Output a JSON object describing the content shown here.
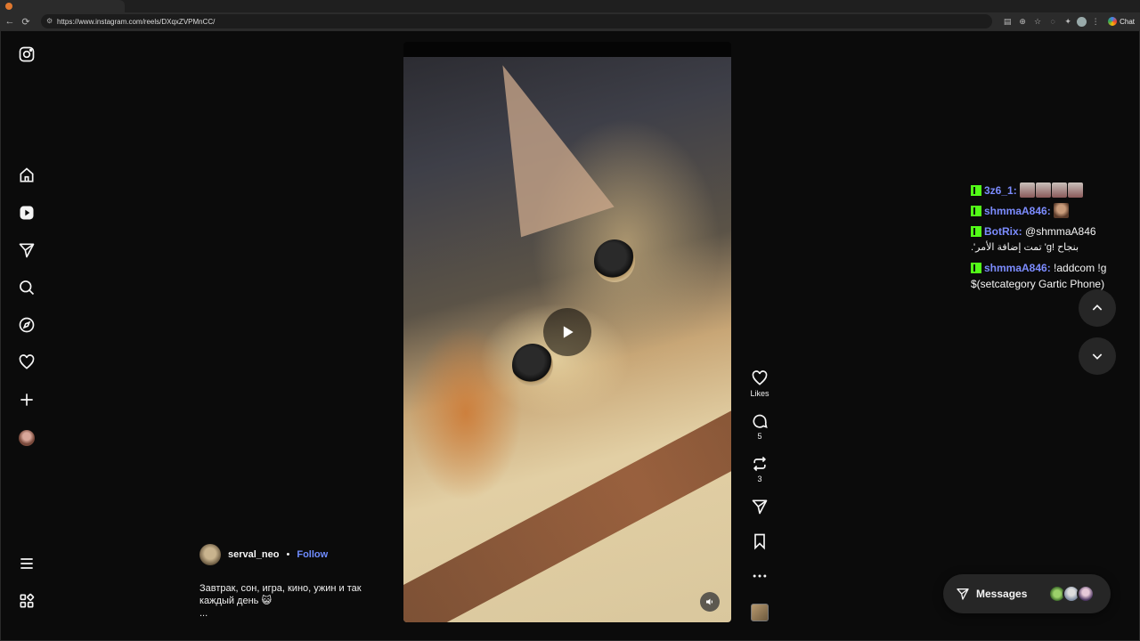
{
  "browser": {
    "url": "https://www.instagram.com/reels/DXqxZVPMnCC/",
    "chat_label": "Chat"
  },
  "nav": {
    "items": [
      "instagram-logo",
      "home-icon",
      "reels-icon",
      "direct-icon",
      "search-icon",
      "explore-icon",
      "heart-icon",
      "create-icon",
      "profile-avatar",
      "menu-icon",
      "more-icon"
    ]
  },
  "reel": {
    "likes_label": "Likes",
    "comments_count": "5",
    "reposts_count": "3"
  },
  "caption": {
    "username": "serval_neo",
    "separator": "•",
    "follow_label": "Follow",
    "text": "Завтрак, сон, игра, кино, ужин и так каждый день 😺",
    "more": "..."
  },
  "chat": {
    "messages": [
      {
        "user": "3z6_1:",
        "text": ""
      },
      {
        "user": "shmmaA846:",
        "text": ""
      },
      {
        "user": "BotRix:",
        "text": "@shmmaA846",
        "text2": "بنجاح !g' تمت إضافة الأمر'."
      },
      {
        "user": "shmmaA846:",
        "text": "!addcom !g $(setcategory Gartic Phone)"
      }
    ]
  },
  "messages": {
    "label": "Messages"
  },
  "colors": {
    "accent_blue": "#6f8cff",
    "kick_green": "#53fc18",
    "chat_username": "#7c8cff"
  }
}
